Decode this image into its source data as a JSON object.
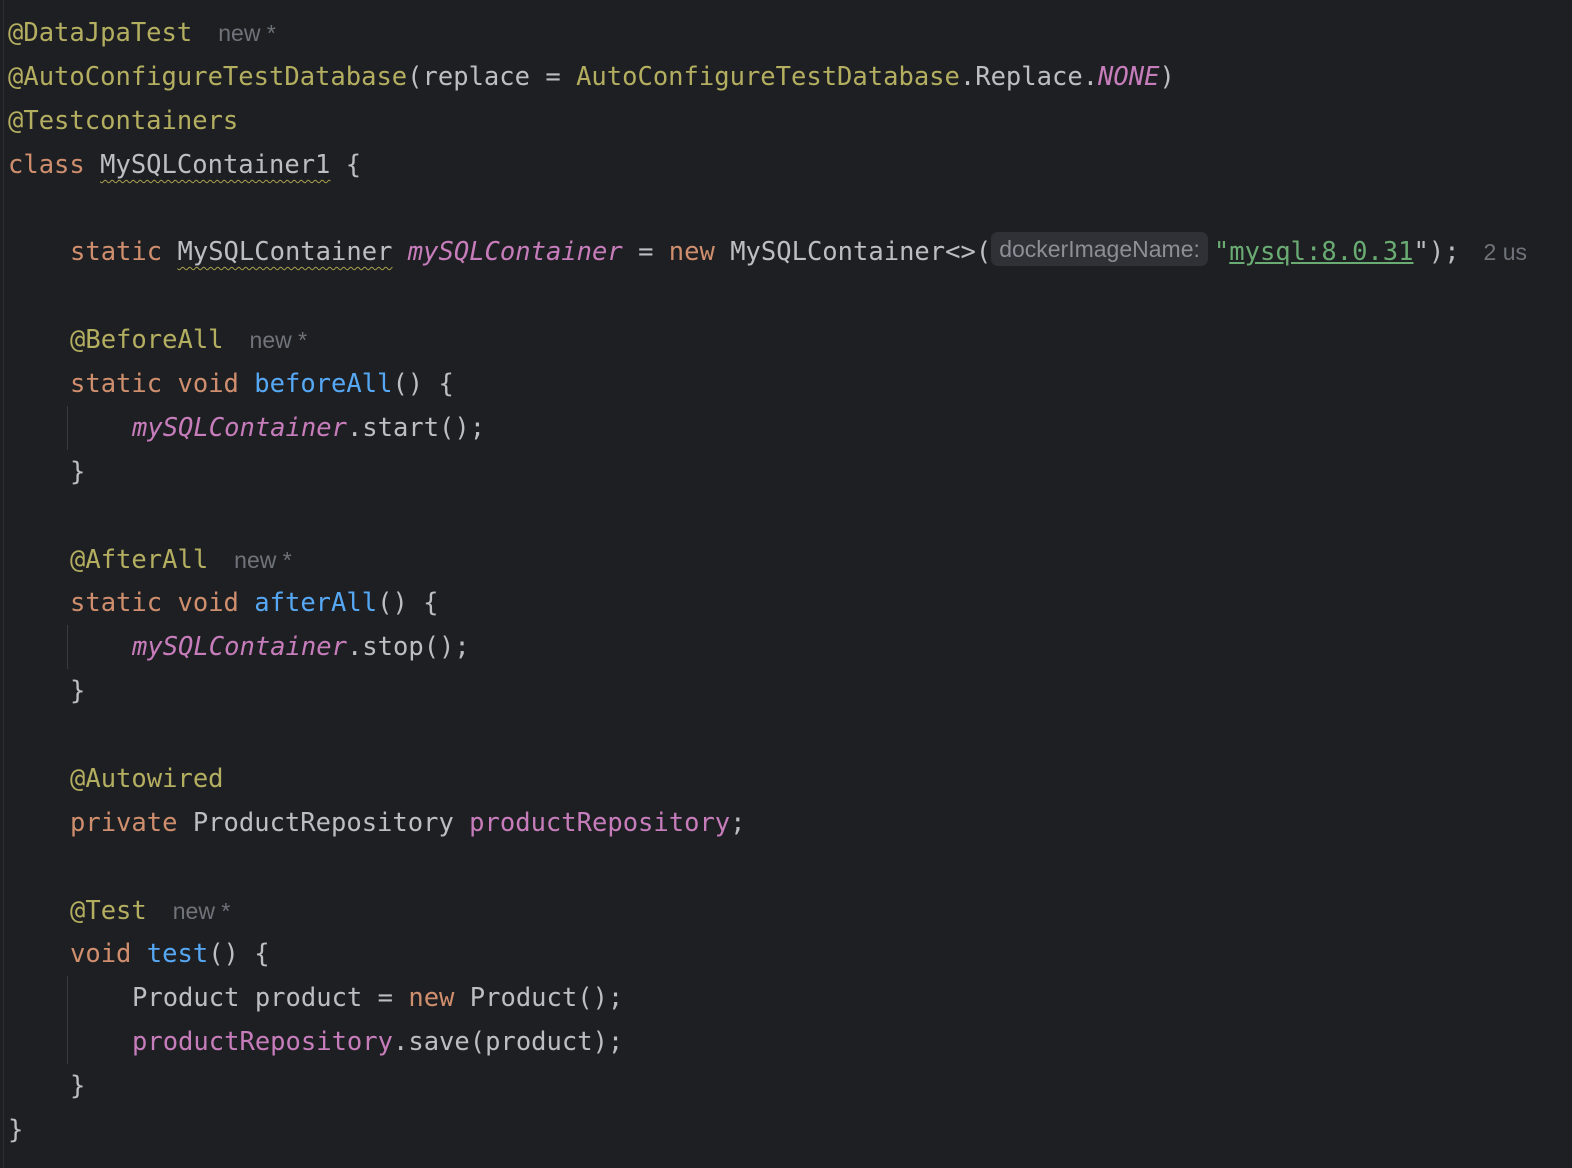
{
  "editor": {
    "hint_new": "new *",
    "line1": {
      "annotation": "@DataJpaTest"
    },
    "line2": {
      "annotation": "@AutoConfigureTestDatabase",
      "open": "(replace = ",
      "class_ref": "AutoConfigureTestDatabase",
      "member": ".Replace.",
      "constant": "NONE",
      "close": ")"
    },
    "line3": {
      "annotation": "@Testcontainers"
    },
    "line4": {
      "keyword": "class",
      "class_name": "MySQLContainer1",
      "brace": "{"
    },
    "line5": {
      "kw_static": "static",
      "type": "MySQLContainer",
      "field": "mySQLContainer",
      "assign": " = ",
      "kw_new": "new",
      "ctor": " MySQLContainer<>(",
      "param_hint": "dockerImageName:",
      "quote_open": "\"",
      "string_value": "mysql:8.0.31",
      "quote_close": "\");",
      "usages": "2 us"
    },
    "before_all": {
      "annotation": "@BeforeAll",
      "kw_static": "static",
      "kw_void": "void",
      "method": "beforeAll",
      "sig_rest": "() {",
      "body_field": "mySQLContainer",
      "body_call": ".start();",
      "close": "}"
    },
    "after_all": {
      "annotation": "@AfterAll",
      "kw_static": "static",
      "kw_void": "void",
      "method": "afterAll",
      "sig_rest": "() {",
      "body_field": "mySQLContainer",
      "body_call": ".stop();",
      "close": "}"
    },
    "autowired": {
      "annotation": "@Autowired",
      "kw_private": "private",
      "type": " ProductRepository ",
      "field": "productRepository",
      "semi": ";"
    },
    "test": {
      "annotation": "@Test",
      "kw_void": "void",
      "method": "test",
      "sig_rest": "() {",
      "stmt1_pre": "Product product = ",
      "stmt1_kw": "new",
      "stmt1_post": " Product();",
      "stmt2_field": "productRepository",
      "stmt2_call": ".save(product);",
      "close": "}"
    },
    "class_close": "}"
  }
}
